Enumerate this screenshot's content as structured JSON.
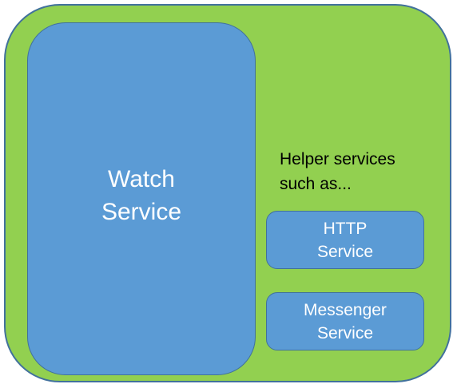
{
  "diagram": {
    "colors": {
      "outer_fill": "#92d050",
      "box_fill": "#5b9bd5",
      "border": "#41719c",
      "box_text": "#ffffff",
      "helper_text": "#000000"
    },
    "watch_service": {
      "line1": "Watch",
      "line2": "Service"
    },
    "helper_text": {
      "line1": "Helper services",
      "line2": "such as..."
    },
    "http_service": {
      "line1": "HTTP",
      "line2": "Service"
    },
    "messenger_service": {
      "line1": "Messenger",
      "line2": "Service"
    }
  }
}
